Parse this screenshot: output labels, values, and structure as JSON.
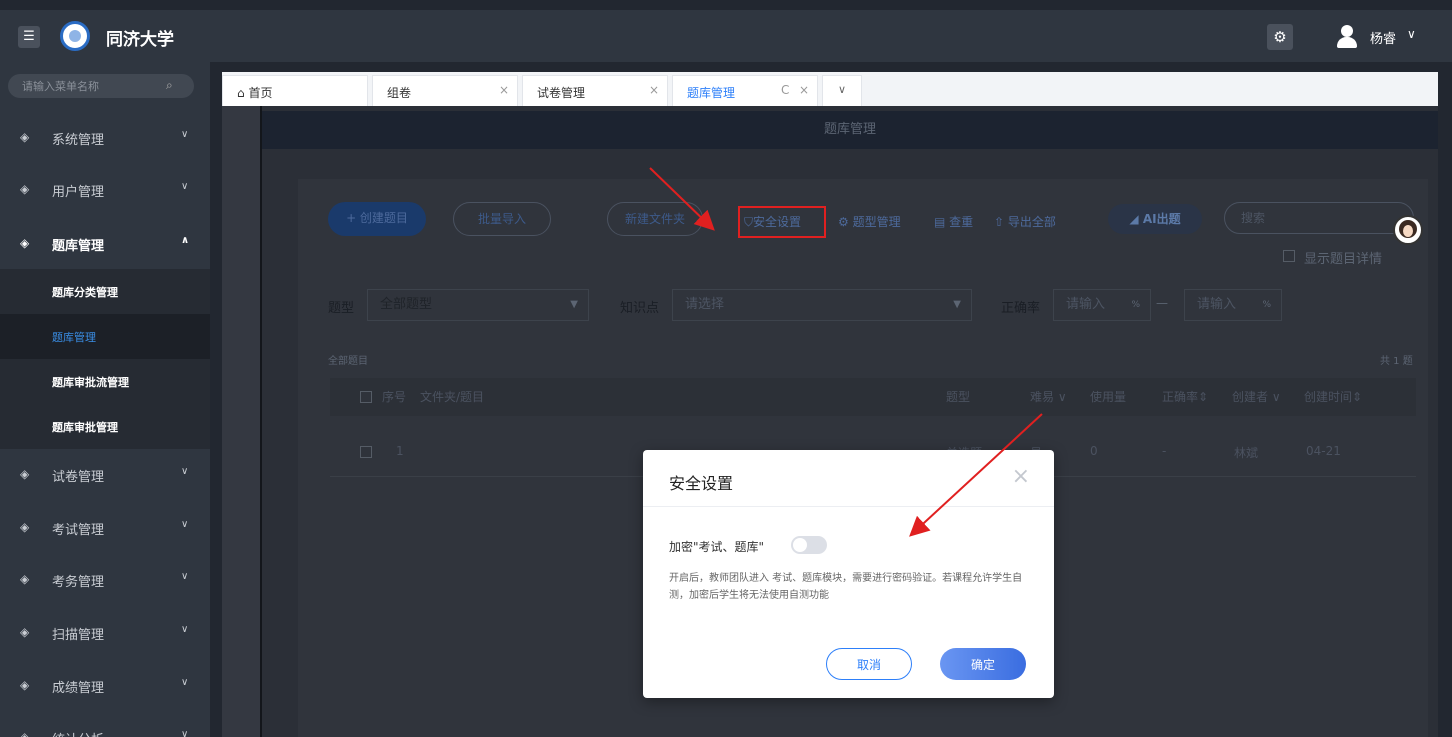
{
  "app": {
    "title": "同济大学",
    "menu_toggle": "☰"
  },
  "header": {
    "settings_icon": "gear-icon",
    "user_name": "杨睿",
    "user_caret": "∨"
  },
  "sidebar": {
    "search_placeholder": "请输入菜单名称",
    "items": [
      {
        "label": "系统管理",
        "chevron": "∨"
      },
      {
        "label": "用户管理",
        "chevron": "∨"
      },
      {
        "label": "题库管理",
        "chevron": "∧",
        "open": true
      },
      {
        "label": "试卷管理",
        "chevron": "∨"
      },
      {
        "label": "考试管理",
        "chevron": "∨"
      },
      {
        "label": "考务管理",
        "chevron": "∨"
      },
      {
        "label": "扫描管理",
        "chevron": "∨"
      },
      {
        "label": "成绩管理",
        "chevron": "∨"
      },
      {
        "label": "统计分析",
        "chevron": "∨"
      }
    ],
    "sub_items": [
      {
        "label": "题库分类管理"
      },
      {
        "label": "题库管理",
        "active": true
      },
      {
        "label": "题库审批流管理"
      },
      {
        "label": "题库审批管理"
      }
    ]
  },
  "tabs": [
    {
      "label": "首页",
      "icon": "home-icon"
    },
    {
      "label": "组卷",
      "close": "×"
    },
    {
      "label": "试卷管理",
      "close": "×"
    },
    {
      "label": "题库管理",
      "refresh": "C",
      "close": "×",
      "active": true
    }
  ],
  "tab_more": "∨",
  "page": {
    "header_title": "题库管理"
  },
  "toolbar": {
    "create_label": "+ 创建题目",
    "import_label": "批量导入",
    "new_folder_label": "新建文件夹",
    "security_label": "安全设置",
    "type_manage_label": "题型管理",
    "dedupe_label": "查重",
    "export_label": "导出全部",
    "ai_label": "AI出题",
    "search_placeholder": "搜索",
    "show_detail_label": "显示题目详情"
  },
  "filters": {
    "type_label": "题型",
    "type_value": "全部题型",
    "knowledge_label": "知识点",
    "knowledge_placeholder": "请选择",
    "accuracy_label": "正确率",
    "accuracy_min_placeholder": "请输入",
    "accuracy_max_placeholder": "请输入",
    "percent": "%",
    "dash": "—"
  },
  "list": {
    "section_label": "全部题目",
    "total_label": "共 1 题",
    "columns": [
      "序号",
      "文件夹/题目",
      "题型",
      "难易",
      "使用量",
      "正确率",
      "创建者",
      "创建时间"
    ],
    "rows": [
      {
        "index": "1",
        "type": "单选题",
        "difficulty": "易",
        "usage": "0",
        "accuracy": "-",
        "creator": "林斌",
        "created": "04-21"
      }
    ]
  },
  "modal": {
    "title": "安全设置",
    "close": "×",
    "toggle_label": "加密\"考试、题库\"",
    "toggle_on": false,
    "description": "开启后，教师团队进入 考试、题库模块，需要进行密码验证。若课程允许学生自测，加密后学生将无法使用自测功能",
    "cancel_label": "取消",
    "confirm_label": "确定"
  },
  "colors": {
    "accent": "#2d7ff9",
    "annotation": "#e02020"
  }
}
